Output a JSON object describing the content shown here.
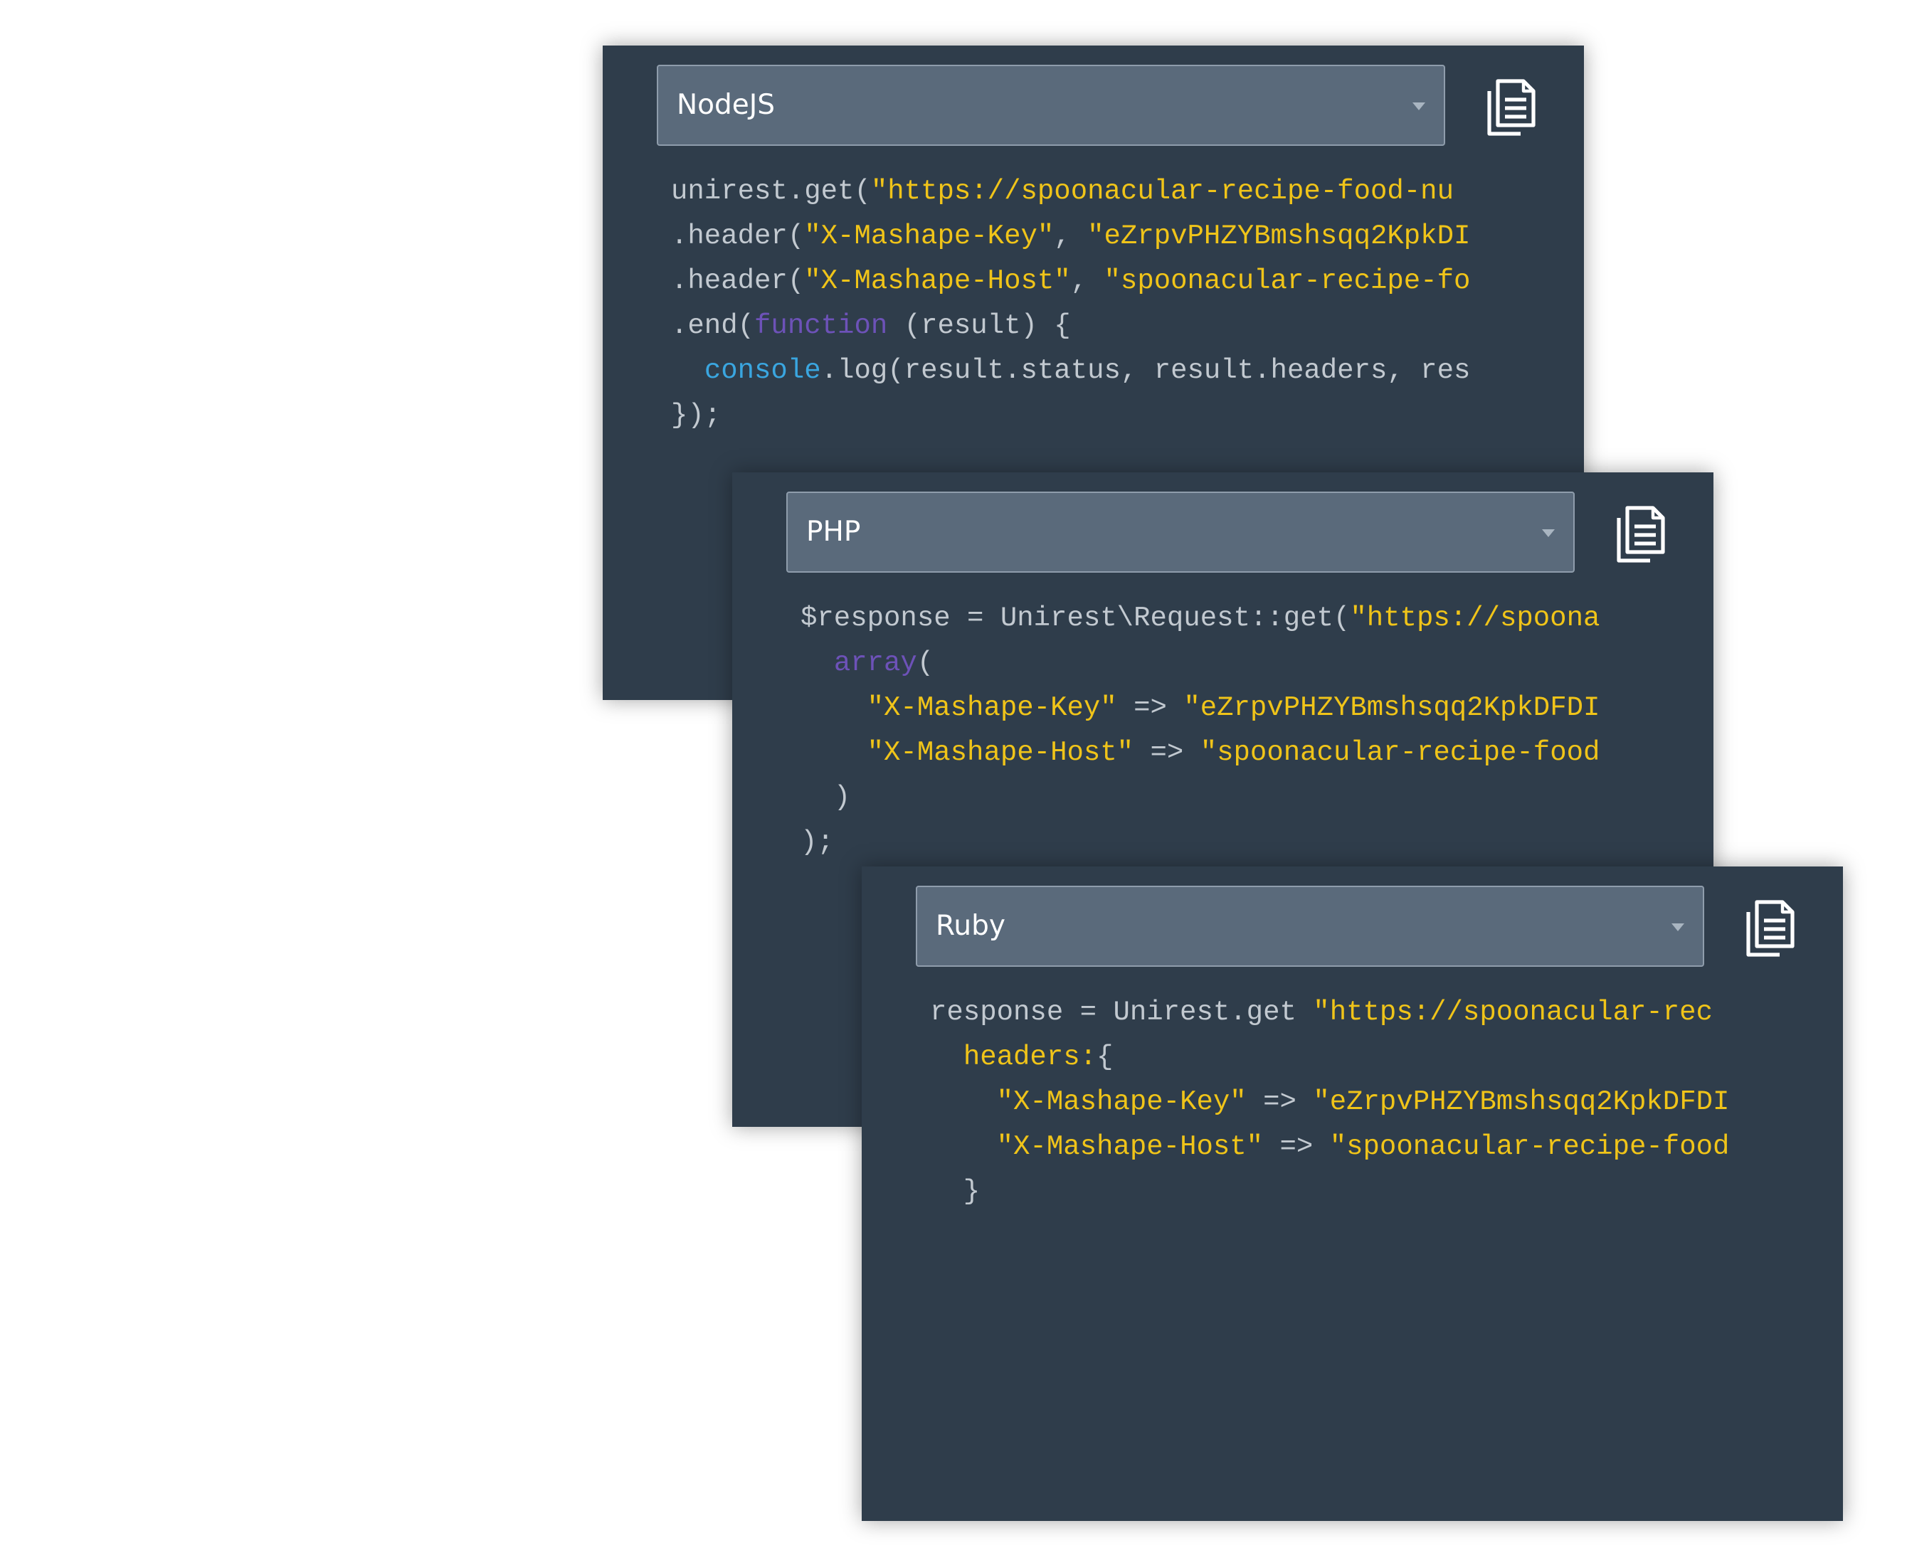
{
  "theme": {
    "panel_bg": "#2f3d4b",
    "select_bg": "#5a6a7b",
    "code_text": "#c2c9d0",
    "string_color": "#f0c419",
    "keyword_color": "#6d52b8",
    "object_color": "#3aa6e0"
  },
  "snippets": [
    {
      "language": "NodeJS",
      "copy_icon": "copy-icon",
      "lines": [
        [
          {
            "t": "unirest.get(",
            "c": "plain"
          },
          {
            "t": "\"https://spoonacular-recipe-food-nu",
            "c": "str"
          }
        ],
        [
          {
            "t": ".header(",
            "c": "plain"
          },
          {
            "t": "\"X-Mashape-Key\"",
            "c": "str"
          },
          {
            "t": ", ",
            "c": "plain"
          },
          {
            "t": "\"eZrpvPHZYBmshsqq2KpkDI",
            "c": "str"
          }
        ],
        [
          {
            "t": ".header(",
            "c": "plain"
          },
          {
            "t": "\"X-Mashape-Host\"",
            "c": "str"
          },
          {
            "t": ", ",
            "c": "plain"
          },
          {
            "t": "\"spoonacular-recipe-fo",
            "c": "str"
          }
        ],
        [
          {
            "t": ".end(",
            "c": "plain"
          },
          {
            "t": "function",
            "c": "kw"
          },
          {
            "t": " (result) {",
            "c": "plain"
          }
        ],
        [
          {
            "t": "  ",
            "c": "plain"
          },
          {
            "t": "console",
            "c": "obj"
          },
          {
            "t": ".log(result.status, result.headers, res",
            "c": "plain"
          }
        ],
        [
          {
            "t": "});",
            "c": "plain"
          }
        ]
      ]
    },
    {
      "language": "PHP",
      "copy_icon": "copy-icon",
      "lines": [
        [
          {
            "t": "$response = Unirest\\Request::get(",
            "c": "plain"
          },
          {
            "t": "\"https://spoona",
            "c": "str"
          }
        ],
        [
          {
            "t": "  ",
            "c": "plain"
          },
          {
            "t": "array",
            "c": "kw"
          },
          {
            "t": "(",
            "c": "plain"
          }
        ],
        [
          {
            "t": "    ",
            "c": "plain"
          },
          {
            "t": "\"X-Mashape-Key\"",
            "c": "str"
          },
          {
            "t": " => ",
            "c": "plain"
          },
          {
            "t": "\"eZrpvPHZYBmshsqq2KpkDFDI",
            "c": "str"
          }
        ],
        [
          {
            "t": "    ",
            "c": "plain"
          },
          {
            "t": "\"X-Mashape-Host\"",
            "c": "str"
          },
          {
            "t": " => ",
            "c": "plain"
          },
          {
            "t": "\"spoonacular-recipe-food",
            "c": "str"
          }
        ],
        [
          {
            "t": "  )",
            "c": "plain"
          }
        ],
        [
          {
            "t": ");",
            "c": "plain"
          }
        ]
      ]
    },
    {
      "language": "Ruby",
      "copy_icon": "copy-icon",
      "lines": [
        [
          {
            "t": "response = Unirest.get ",
            "c": "plain"
          },
          {
            "t": "\"https://spoonacular-rec",
            "c": "str"
          }
        ],
        [
          {
            "t": "  ",
            "c": "plain"
          },
          {
            "t": "headers:",
            "c": "str"
          },
          {
            "t": "{",
            "c": "plain"
          }
        ],
        [
          {
            "t": "    ",
            "c": "plain"
          },
          {
            "t": "\"X-Mashape-Key\"",
            "c": "str"
          },
          {
            "t": " => ",
            "c": "plain"
          },
          {
            "t": "\"eZrpvPHZYBmshsqq2KpkDFDI",
            "c": "str"
          }
        ],
        [
          {
            "t": "    ",
            "c": "plain"
          },
          {
            "t": "\"X-Mashape-Host\"",
            "c": "str"
          },
          {
            "t": " => ",
            "c": "plain"
          },
          {
            "t": "\"spoonacular-recipe-food",
            "c": "str"
          }
        ],
        [
          {
            "t": "  }",
            "c": "plain"
          }
        ]
      ]
    }
  ]
}
